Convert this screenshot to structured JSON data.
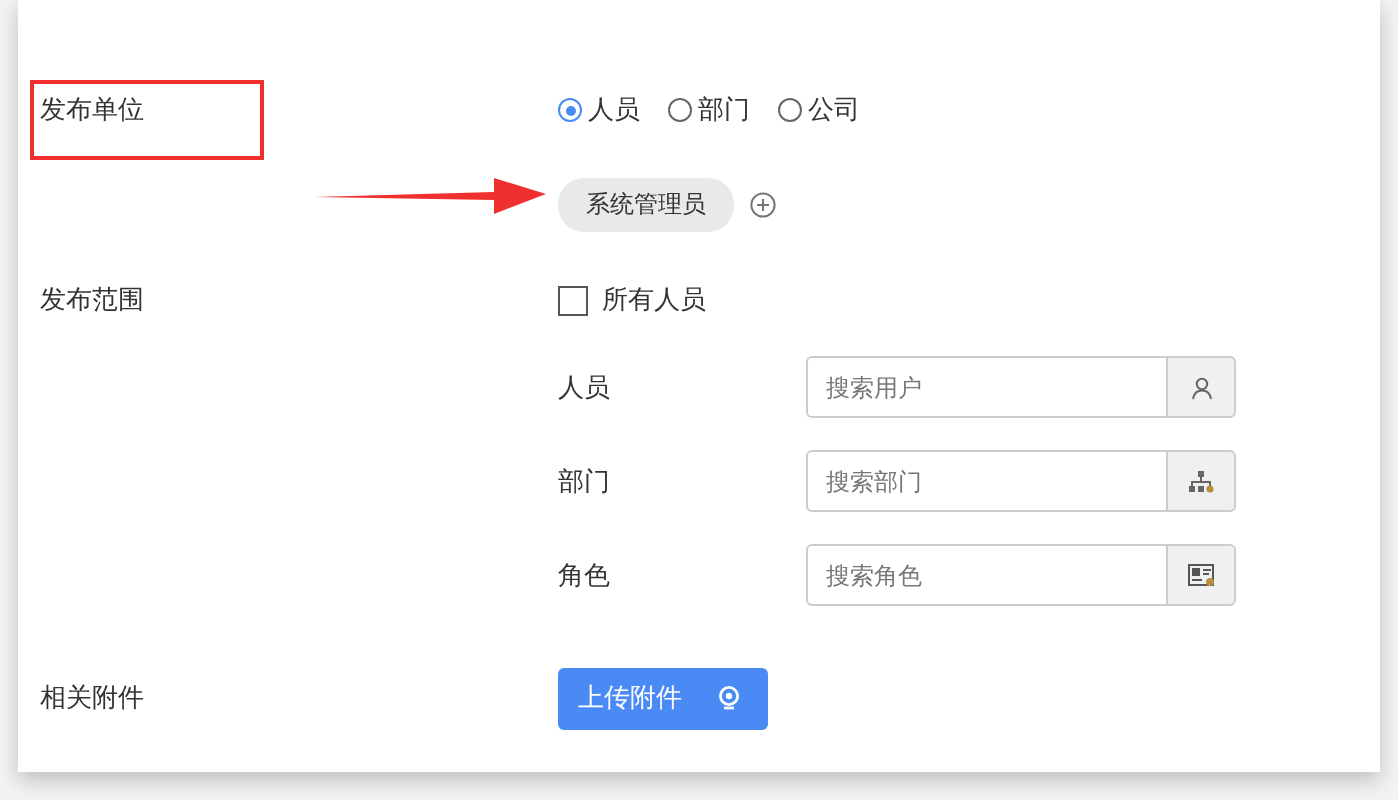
{
  "publisher": {
    "label": "发布单位",
    "options": [
      {
        "label": "人员",
        "selected": true
      },
      {
        "label": "部门",
        "selected": false
      },
      {
        "label": "公司",
        "selected": false
      }
    ],
    "tags": [
      {
        "label": "系统管理员"
      }
    ]
  },
  "scope": {
    "label": "发布范围",
    "all_people": {
      "label": "所有人员",
      "checked": false
    },
    "searches": [
      {
        "label": "人员",
        "placeholder": "搜索用户",
        "kind": "user"
      },
      {
        "label": "部门",
        "placeholder": "搜索部门",
        "kind": "department"
      },
      {
        "label": "角色",
        "placeholder": "搜索角色",
        "kind": "role"
      }
    ]
  },
  "attachments": {
    "label": "相关附件",
    "button": "上传附件"
  }
}
